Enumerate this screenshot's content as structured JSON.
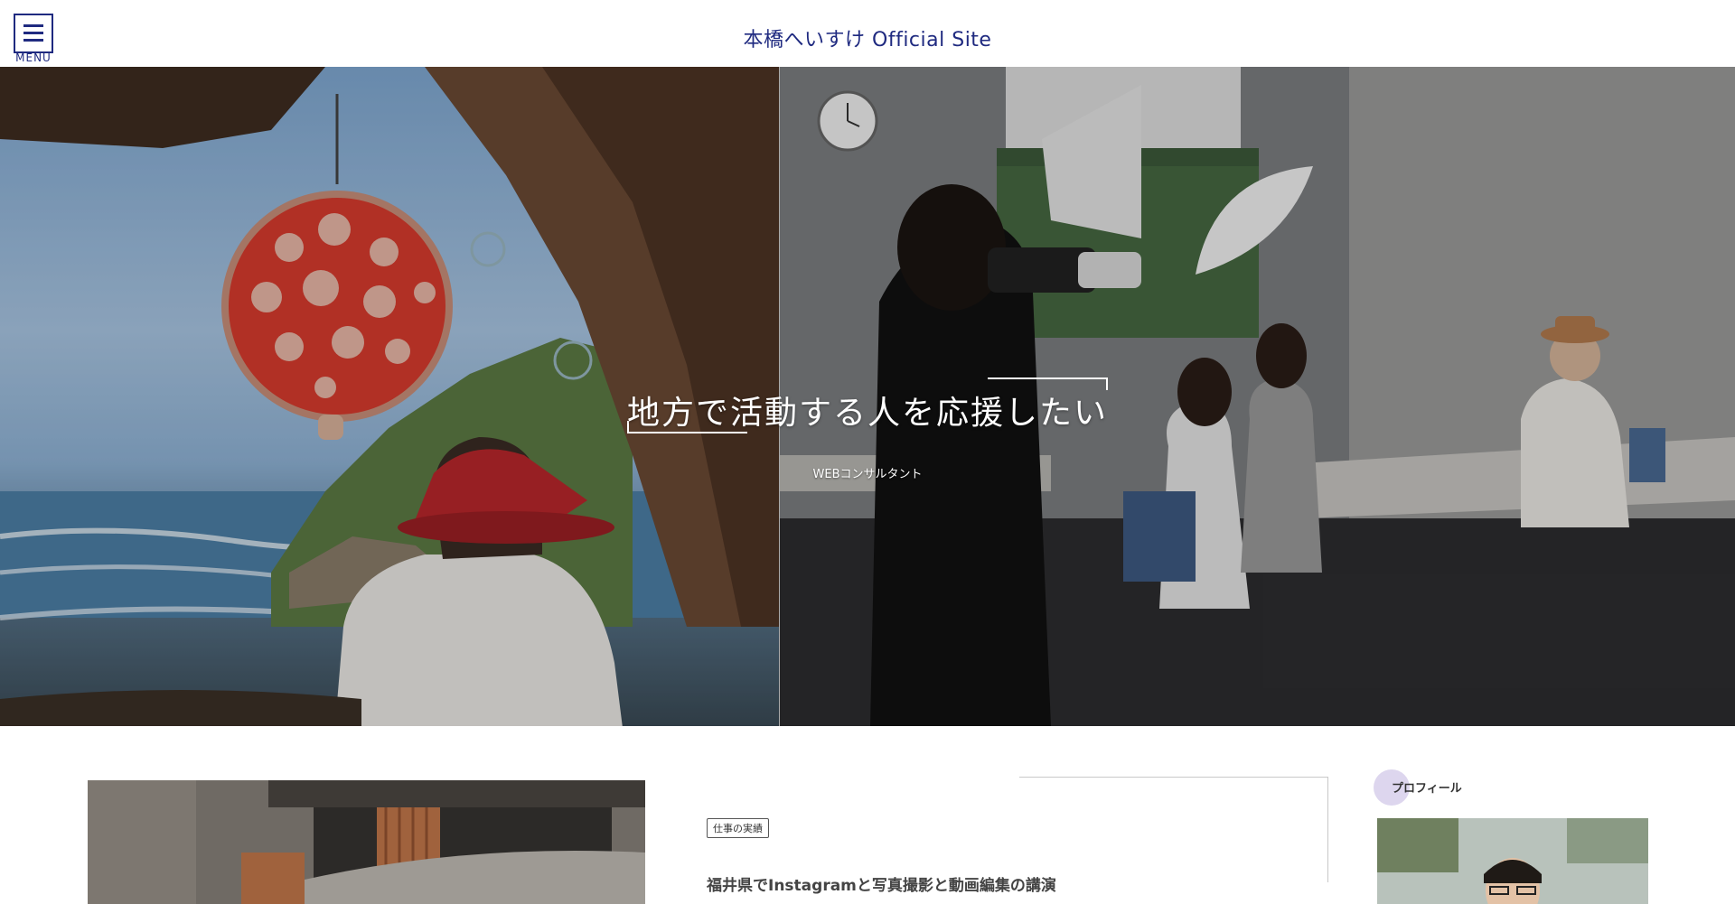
{
  "header": {
    "menu_label": "MENU",
    "site_title": "本橋へいすけ Official Site"
  },
  "hero": {
    "headline": "地方で活動する人を応援したい",
    "subtitle": "WEBコンサルタント"
  },
  "post": {
    "category": "仕事の実績",
    "title": "福井県でInstagramと写真撮影と動画編集の講演"
  },
  "sidebar": {
    "profile_heading": "プロフィール"
  },
  "colors": {
    "brand": "#1f2a80",
    "accent_circle": "#ddd6ee"
  },
  "icons": {
    "menu": "hamburger-icon"
  }
}
